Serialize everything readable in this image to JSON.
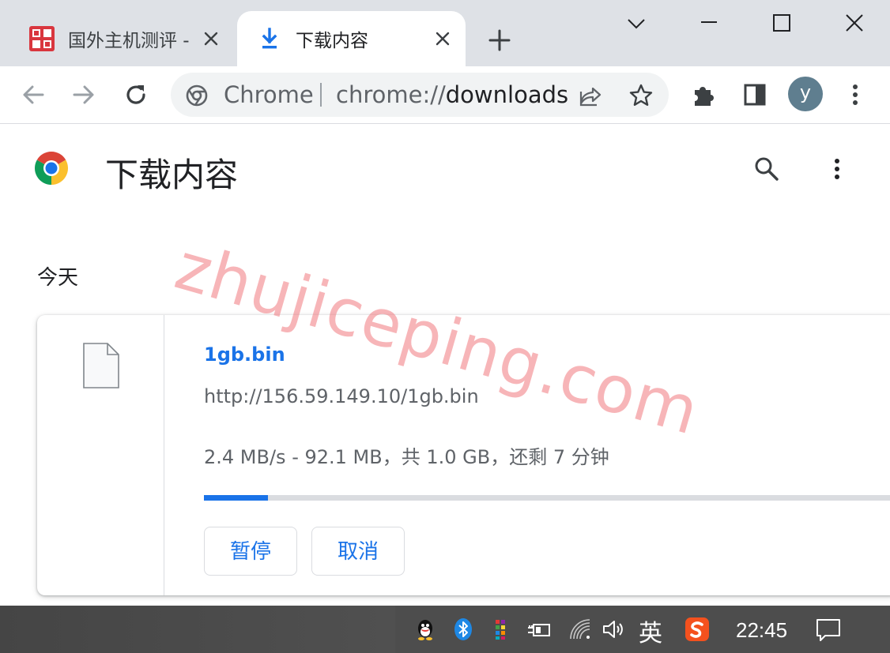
{
  "tabs": [
    {
      "title": "国外主机测评 - 国外",
      "state": "inactive",
      "favicon": "site-logo-icon"
    },
    {
      "title": "下载内容",
      "state": "active",
      "favicon": "download-icon"
    }
  ],
  "window_controls": [
    "tab-search-icon",
    "minimize-icon",
    "maximize-icon",
    "close-icon"
  ],
  "omnibox": {
    "site_label": "Chrome",
    "url_prefix": "chrome://",
    "url_host": "downloads"
  },
  "profile": {
    "initial": "y"
  },
  "page": {
    "title": "下载内容",
    "watermark": "zhujiceping.com",
    "section_label": "今天"
  },
  "download": {
    "filename": "1gb.bin",
    "url": "http://156.59.149.10/1gb.bin",
    "status": "2.4 MB/s - 92.1 MB，共 1.0 GB，还剩 7 分钟",
    "progress_fraction": 0.092,
    "pause_label": "暂停",
    "cancel_label": "取消"
  },
  "taskbar": {
    "ime_label": "英",
    "clock": "22:45",
    "tray_icons": [
      "qq-icon",
      "bluetooth-icon",
      "app-grid-icon",
      "power-icon",
      "wifi-icon",
      "volume-icon",
      "sogou-icon",
      "notification-icon"
    ]
  },
  "colors": {
    "accent": "#1a73e8",
    "tab_strip": "#dee1e6",
    "watermark": "#f0787d",
    "taskbar": "#4d4d4d"
  }
}
